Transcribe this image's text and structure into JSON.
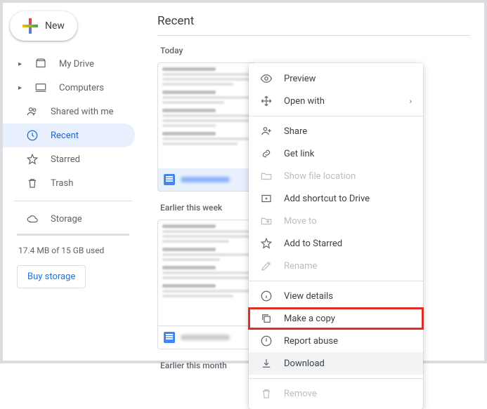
{
  "sidebar": {
    "new": "New",
    "items": [
      {
        "label": "My Drive"
      },
      {
        "label": "Computers"
      },
      {
        "label": "Shared with me"
      },
      {
        "label": "Recent"
      },
      {
        "label": "Starred"
      },
      {
        "label": "Trash"
      }
    ],
    "storage_label": "Storage",
    "storage_used": "17.4 MB of 15 GB used",
    "buy": "Buy storage"
  },
  "main": {
    "title": "Recent",
    "sections": [
      {
        "label": "Today"
      },
      {
        "label": "Earlier this week"
      },
      {
        "label": "Earlier this month"
      }
    ]
  },
  "menu": {
    "preview": "Preview",
    "open_with": "Open with",
    "share": "Share",
    "get_link": "Get link",
    "show_location": "Show file location",
    "add_shortcut": "Add shortcut to Drive",
    "move_to": "Move to",
    "add_starred": "Add to Starred",
    "rename": "Rename",
    "view_details": "View details",
    "make_copy": "Make a copy",
    "report_abuse": "Report abuse",
    "download": "Download",
    "remove": "Remove"
  }
}
